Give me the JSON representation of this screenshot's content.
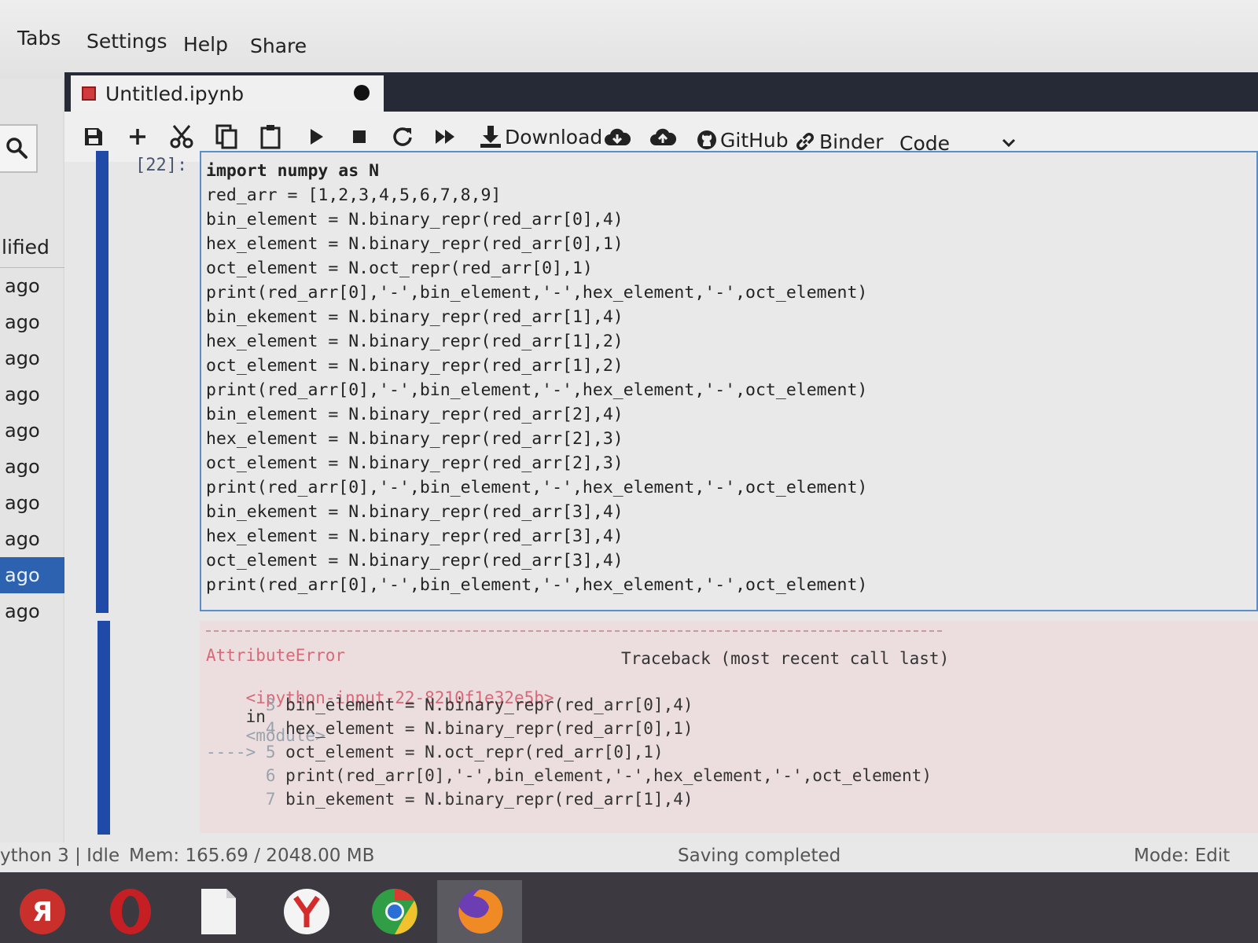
{
  "menu": {
    "items": [
      "Tabs",
      "Settings",
      "Help",
      "Share"
    ]
  },
  "sidebar": {
    "header": "lified",
    "items": [
      "ago",
      "ago",
      "ago",
      "ago",
      "ago",
      "ago",
      "ago",
      "ago",
      "ago",
      "ago"
    ],
    "selected_index": 8
  },
  "tab": {
    "title": "Untitled.ipynb"
  },
  "toolbar": {
    "download_label": "Download",
    "github_label": "GitHub",
    "binder_label": "Binder",
    "cell_type": "Code"
  },
  "cell": {
    "prompt": "[22]:",
    "code_lines": [
      "import numpy as N",
      "red_arr = [1,2,3,4,5,6,7,8,9]",
      "bin_element = N.binary_repr(red_arr[0],4)",
      "hex_element = N.binary_repr(red_arr[0],1)",
      "oct_element = N.oct_repr(red_arr[0],1)",
      "print(red_arr[0],'-',bin_element,'-',hex_element,'-',oct_element)",
      "bin_ekement = N.binary_repr(red_arr[1],4)",
      "hex_element = N.binary_repr(red_arr[1],2)",
      "oct_element = N.binary_repr(red_arr[1],2)",
      "print(red_arr[0],'-',bin_element,'-',hex_element,'-',oct_element)",
      "bin_element = N.binary_repr(red_arr[2],4)",
      "hex_element = N.binary_repr(red_arr[2],3)",
      "oct_element = N.binary_repr(red_arr[2],3)",
      "print(red_arr[0],'-',bin_element,'-',hex_element,'-',oct_element)",
      "bin_ekement = N.binary_repr(red_arr[3],4)",
      "hex_element = N.binary_repr(red_arr[3],4)",
      "oct_element = N.binary_repr(red_arr[3],4)",
      "print(red_arr[0],'-',bin_element,'-',hex_element,'-',oct_element)"
    ]
  },
  "output": {
    "error_name": "AttributeError",
    "traceback_header": "Traceback (most recent call last)",
    "input_ref": "<ipython-input-22-8210f1e32e5b>",
    "in_word": "in",
    "module_ref": "<module>",
    "trace_lines": [
      {
        "prefix": "      3 ",
        "text": "bin_element = N.binary_repr(red_arr[0],4)"
      },
      {
        "prefix": "      4 ",
        "text": "hex_element = N.binary_repr(red_arr[0],1)"
      },
      {
        "prefix": "----> 5 ",
        "text": "oct_element = N.oct_repr(red_arr[0],1)"
      },
      {
        "prefix": "      6 ",
        "text": "print(red_arr[0],'-',bin_element,'-',hex_element,'-',oct_element)"
      },
      {
        "prefix": "      7 ",
        "text": "bin_ekement = N.binary_repr(red_arr[1],4)"
      }
    ]
  },
  "status": {
    "kernel": "ython 3 | Idle",
    "memory": "Mem: 165.69 / 2048.00 MB",
    "message": "Saving completed",
    "mode": "Mode: Edit"
  },
  "taskbar": {
    "apps": [
      "yandex-browser-icon",
      "opera-icon",
      "files-icon",
      "yandex-icon",
      "chrome-icon",
      "firefox-icon"
    ],
    "active_index": 5
  },
  "colors": {
    "accent_blue": "#1f4aa8",
    "selected_sidebar": "#2c62b0",
    "error_background": "#ecdede",
    "tab_bar": "#262a36"
  }
}
